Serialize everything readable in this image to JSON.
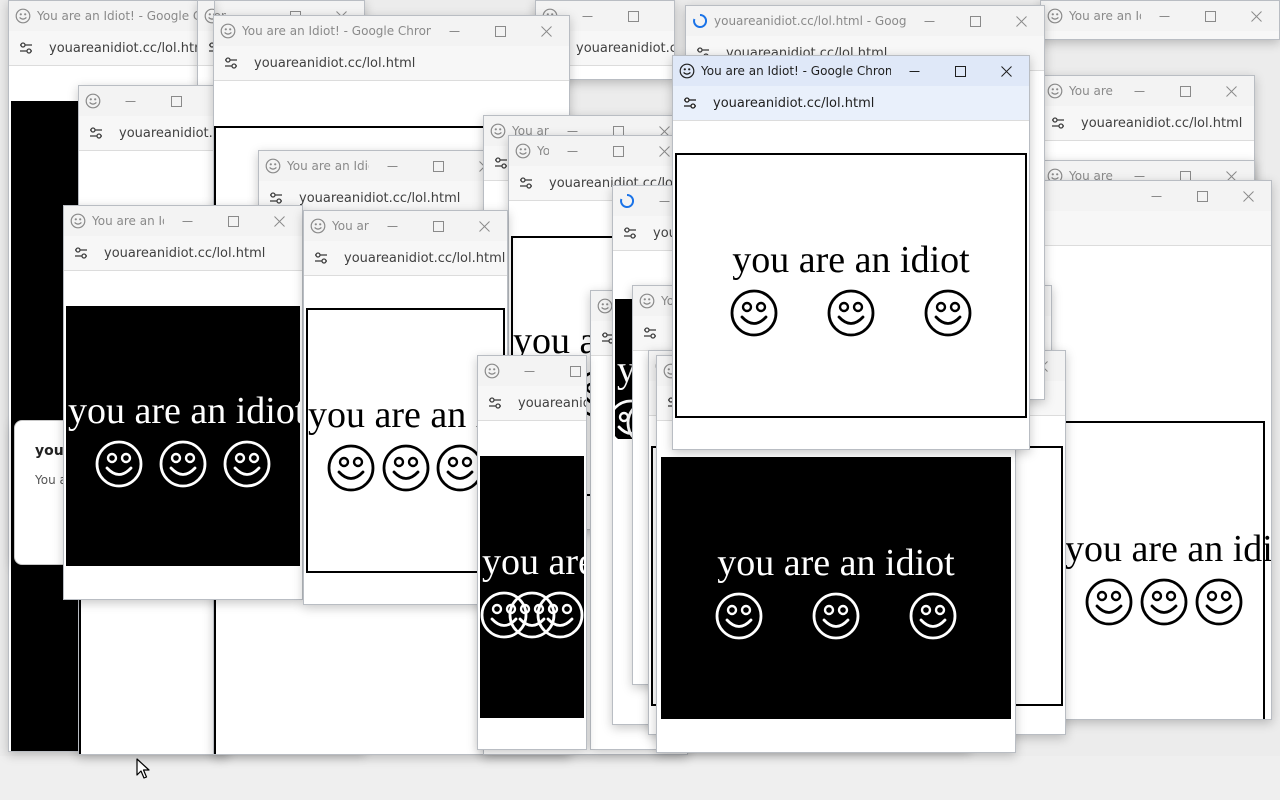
{
  "window": {
    "title": "You are an Idiot! - Google Chrome",
    "title_loading": "youareanidiot.cc/lol.html - Google...",
    "title_loading_short": "youareanidiot.cc/lol.html - Google Chrome",
    "url": "youareanidiot.cc/lol.html"
  },
  "page": {
    "headline": "you are an idiot",
    "smiley_icon": "smiling-face-icon"
  },
  "dialog": {
    "title": "youareanidiot.cc says",
    "message": "You are an idiot"
  },
  "icons": {
    "favicon": "smiley-favicon-icon",
    "site_info": "tune-icon",
    "minimize": "minimize-icon",
    "maximize": "maximize-icon",
    "close": "close-icon",
    "loading": "loading-spinner-icon"
  },
  "colors": {
    "active_titlebar": "#dfe8f8",
    "inactive_titlebar": "#f3f3f3",
    "panel_black": "#000000",
    "panel_white": "#ffffff"
  }
}
